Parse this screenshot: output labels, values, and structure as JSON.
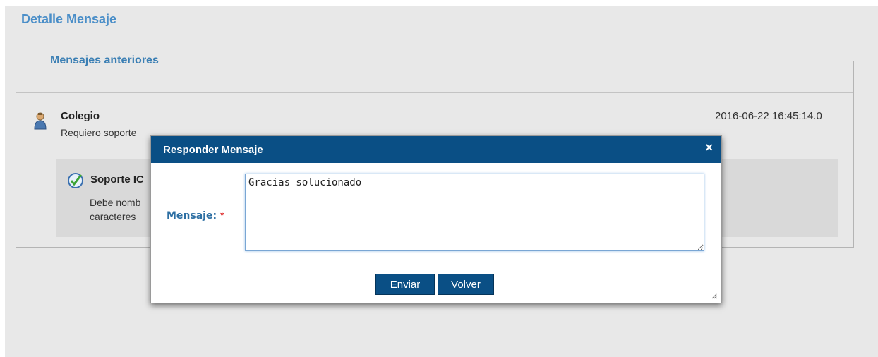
{
  "page": {
    "title": "Detalle Mensaje",
    "section_legend": "Mensajes anteriores"
  },
  "message": {
    "sender": "Colegio",
    "timestamp": "2016-06-22 16:45:14.0",
    "text": "Requiero soporte"
  },
  "reply": {
    "sender": "Soporte IC",
    "text_line1": "Debe nomb",
    "text_line2": "caracteres"
  },
  "dialog": {
    "title": "Responder Mensaje",
    "close_symbol": "×",
    "field_label": "Mensaje:",
    "required_mark": "*",
    "message_value": "Gracias solucionado",
    "send_label": "Enviar",
    "back_label": "Volver"
  },
  "colors": {
    "header_blue": "#0a4f85",
    "title_blue": "#4a8ec8",
    "panel_bg": "#e8e8e8"
  },
  "icons": {
    "user": "user-icon",
    "check": "check-icon",
    "close": "close-icon",
    "grip": "resize-grip-icon"
  }
}
